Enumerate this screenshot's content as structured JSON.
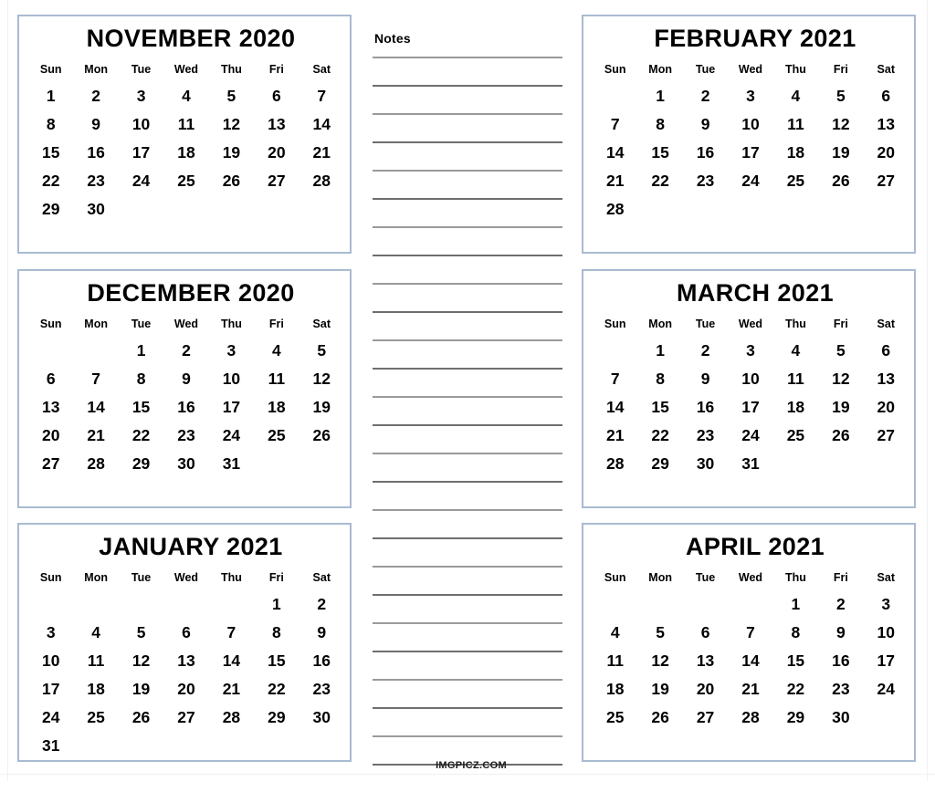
{
  "page": {
    "watermark": "IMGPICZ.COM",
    "border_color": "#a9bbd0",
    "text_color": "#000000",
    "note_line_color": "#6e6e6e",
    "background": "#ffffff"
  },
  "weekdays": [
    "Sun",
    "Mon",
    "Tue",
    "Wed",
    "Thu",
    "Fri",
    "Sat"
  ],
  "notes": {
    "title": "Notes",
    "line_count": 26
  },
  "months": [
    {
      "id": "november-2020",
      "title": "NOVEMBER 2020",
      "month_name": "NOVEMBER",
      "year": "2020",
      "first_weekday_index": 0,
      "days_in_month": 30,
      "weeks": [
        [
          "1",
          "2",
          "3",
          "4",
          "5",
          "6",
          "7"
        ],
        [
          "8",
          "9",
          "10",
          "11",
          "12",
          "13",
          "14"
        ],
        [
          "15",
          "16",
          "17",
          "18",
          "19",
          "20",
          "21"
        ],
        [
          "22",
          "23",
          "24",
          "25",
          "26",
          "27",
          "28"
        ],
        [
          "29",
          "30",
          "",
          "",
          "",
          "",
          ""
        ]
      ]
    },
    {
      "id": "december-2020",
      "title": "DECEMBER 2020",
      "month_name": "DECEMBER",
      "year": "2020",
      "first_weekday_index": 2,
      "days_in_month": 31,
      "weeks": [
        [
          "",
          "",
          "1",
          "2",
          "3",
          "4",
          "5"
        ],
        [
          "6",
          "7",
          "8",
          "9",
          "10",
          "11",
          "12"
        ],
        [
          "13",
          "14",
          "15",
          "16",
          "17",
          "18",
          "19"
        ],
        [
          "20",
          "21",
          "22",
          "23",
          "24",
          "25",
          "26"
        ],
        [
          "27",
          "28",
          "29",
          "30",
          "31",
          "",
          ""
        ]
      ]
    },
    {
      "id": "january-2021",
      "title": "JANUARY 2021",
      "month_name": "JANUARY",
      "year": "2021",
      "first_weekday_index": 5,
      "days_in_month": 31,
      "weeks": [
        [
          "",
          "",
          "",
          "",
          "",
          "1",
          "2"
        ],
        [
          "3",
          "4",
          "5",
          "6",
          "7",
          "8",
          "9"
        ],
        [
          "10",
          "11",
          "12",
          "13",
          "14",
          "15",
          "16"
        ],
        [
          "17",
          "18",
          "19",
          "20",
          "21",
          "22",
          "23"
        ],
        [
          "24",
          "25",
          "26",
          "27",
          "28",
          "29",
          "30"
        ],
        [
          "31",
          "",
          "",
          "",
          "",
          "",
          ""
        ]
      ]
    },
    {
      "id": "february-2021",
      "title": "FEBRUARY 2021",
      "month_name": "FEBRUARY",
      "year": "2021",
      "first_weekday_index": 1,
      "days_in_month": 28,
      "weeks": [
        [
          "",
          "1",
          "2",
          "3",
          "4",
          "5",
          "6"
        ],
        [
          "7",
          "8",
          "9",
          "10",
          "11",
          "12",
          "13"
        ],
        [
          "14",
          "15",
          "16",
          "17",
          "18",
          "19",
          "20"
        ],
        [
          "21",
          "22",
          "23",
          "24",
          "25",
          "26",
          "27"
        ],
        [
          "28",
          "",
          "",
          "",
          "",
          "",
          ""
        ]
      ]
    },
    {
      "id": "march-2021",
      "title": "MARCH 2021",
      "month_name": "MARCH",
      "year": "2021",
      "first_weekday_index": 1,
      "days_in_month": 31,
      "weeks": [
        [
          "",
          "1",
          "2",
          "3",
          "4",
          "5",
          "6"
        ],
        [
          "7",
          "8",
          "9",
          "10",
          "11",
          "12",
          "13"
        ],
        [
          "14",
          "15",
          "16",
          "17",
          "18",
          "19",
          "20"
        ],
        [
          "21",
          "22",
          "23",
          "24",
          "25",
          "26",
          "27"
        ],
        [
          "28",
          "29",
          "30",
          "31",
          "",
          "",
          ""
        ]
      ]
    },
    {
      "id": "april-2021",
      "title": "APRIL 2021",
      "month_name": "APRIL",
      "year": "2021",
      "first_weekday_index": 4,
      "days_in_month": 30,
      "weeks": [
        [
          "",
          "",
          "",
          "",
          "1",
          "2",
          "3"
        ],
        [
          "4",
          "5",
          "6",
          "7",
          "8",
          "9",
          "10"
        ],
        [
          "11",
          "12",
          "13",
          "14",
          "15",
          "16",
          "17"
        ],
        [
          "18",
          "19",
          "20",
          "21",
          "22",
          "23",
          "24"
        ],
        [
          "25",
          "26",
          "27",
          "28",
          "29",
          "30",
          ""
        ]
      ]
    }
  ]
}
